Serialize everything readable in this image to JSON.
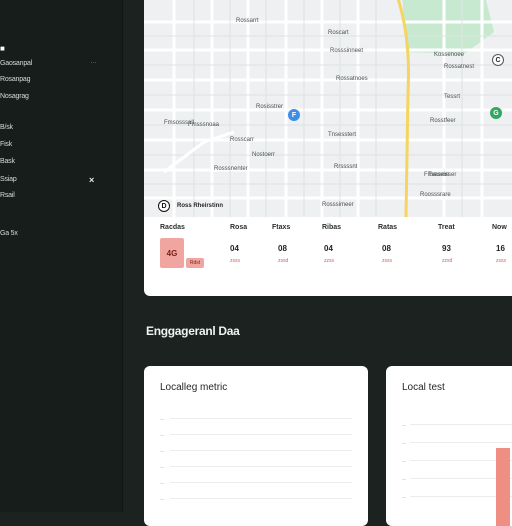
{
  "sidebar": {
    "items": [
      {
        "label": "■"
      },
      {
        "label": "Gaosanpal"
      },
      {
        "label": "Rosanpag"
      },
      {
        "label": "Nosagrag"
      },
      {
        "label": "B/sk"
      },
      {
        "label": "Fisk"
      },
      {
        "label": "Bask"
      },
      {
        "label": "Ssiap"
      },
      {
        "label": "Rsail"
      },
      {
        "label": "Ga 5x"
      }
    ],
    "dot": "…",
    "close_icon": "×"
  },
  "map": {
    "labels": [
      "Fmsosssall",
      "Rosscarr",
      "Rossarrt",
      "Rosisstrer",
      "Tnsesstert",
      "Rosssinneet",
      "Rossatnoes",
      "Rosssimeer",
      "Rossatnest",
      "Frnouvnn",
      "Rosssnenter",
      "Tessrt",
      "Kossenoee",
      "Rrssssnt",
      "Fmsssnoaa",
      "Nostoerr",
      "Rosstfeer",
      "Roscart",
      "Tsesaisser",
      "Roosssrare",
      "Ross Rheirstinn"
    ],
    "pin_blue": "F",
    "pin_green": "G",
    "pin_right": "C",
    "pin_bottom": "D"
  },
  "stats": [
    {
      "header": "Racdas",
      "value": "4G",
      "sub": "Rdst"
    },
    {
      "header": "Rosa",
      "value": "04",
      "sub": "zsss"
    },
    {
      "header": "Ftaxs",
      "value": "08",
      "sub": "zssd"
    },
    {
      "header": "Ribas",
      "value": "04",
      "sub": "zzss"
    },
    {
      "header": "Ratas",
      "value": "08",
      "sub": "zsss"
    },
    {
      "header": "Treat",
      "value": "93",
      "sub": "zzsd"
    },
    {
      "header": "Now",
      "value": "16",
      "sub": "zsss"
    }
  ],
  "section": {
    "title": "Enggageranl Daa"
  },
  "cards": [
    {
      "title": "Localleg metric"
    },
    {
      "title": "Local test"
    }
  ],
  "colors": {
    "accent": "#ef8f83",
    "bg": "#1b2220",
    "road_major": "#f5d562",
    "park": "#c7e9d0"
  }
}
